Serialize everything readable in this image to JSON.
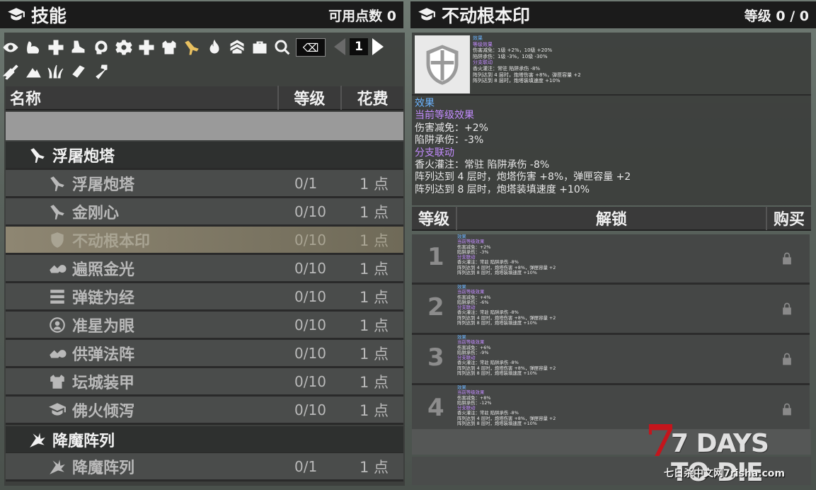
{
  "left": {
    "title": "技能",
    "points_label": "可用点数 0",
    "page_number": "1",
    "columns": {
      "name": "名称",
      "level": "等级",
      "cost": "花费"
    },
    "category1": {
      "name": "浮屠炮塔"
    },
    "skills": [
      {
        "name": "浮屠炮塔",
        "level": "0/1",
        "cost": "1 点",
        "icon": "turret-icon"
      },
      {
        "name": "金刚心",
        "level": "0/10",
        "cost": "1 点",
        "icon": "turret-icon"
      },
      {
        "name": "不动根本印",
        "level": "0/10",
        "cost": "1 点",
        "icon": "shield-icon"
      },
      {
        "name": "遍照金光",
        "level": "0/10",
        "cost": "1 点",
        "icon": "sawblade-icon"
      },
      {
        "name": "弹链为经",
        "level": "0/10",
        "cost": "1 点",
        "icon": "ammo-belt-icon"
      },
      {
        "name": "准星为眼",
        "level": "0/10",
        "cost": "1 点",
        "icon": "crosshair-person-icon"
      },
      {
        "name": "供弹法阵",
        "level": "0/10",
        "cost": "1 点",
        "icon": "sawblade-icon"
      },
      {
        "name": "坛城装甲",
        "level": "0/10",
        "cost": "1 点",
        "icon": "armor-icon"
      },
      {
        "name": "佛火倾泻",
        "level": "0/10",
        "cost": "1 点",
        "icon": "graduation-cap-icon"
      }
    ],
    "category2": {
      "name": "降魔阵列"
    },
    "skill_last": {
      "name": "降魔阵列",
      "level": "0/1",
      "cost": "1 点"
    }
  },
  "right": {
    "title": "不动根本印",
    "level_label": "等级 0 / 0",
    "mini": [
      {
        "t": "效果",
        "c": "blue"
      },
      {
        "t": "等级效果",
        "c": "purple"
      },
      {
        "t": "伤害减免：1级 +2%，10级 +20%",
        "c": "white"
      },
      {
        "t": "陷阱承伤：1级 -3%，10级 -30%",
        "c": "white"
      },
      {
        "t": "分支联动",
        "c": "purple"
      },
      {
        "t": "香火灌注：常驻 陷阱承伤 -8%",
        "c": "white"
      },
      {
        "t": "阵列达到 4 层时，炮塔伤害 +8%，弹匣容量 +2",
        "c": "white"
      },
      {
        "t": "阵列达到 8 层时，炮塔装填速度 +10%",
        "c": "white"
      }
    ],
    "desc": [
      {
        "t": "效果",
        "c": "blue"
      },
      {
        "t": "当前等级效果",
        "c": "purple"
      },
      {
        "t": "伤害减免：+2%",
        "c": "white"
      },
      {
        "t": "陷阱承伤：-3%",
        "c": "white"
      },
      {
        "t": "分支联动",
        "c": "purple"
      },
      {
        "t": "香火灌注：常驻 陷阱承伤 -8%",
        "c": "white"
      },
      {
        "t": "阵列达到 4 层时，炮塔伤害 +8%，弹匣容量 +2",
        "c": "white"
      },
      {
        "t": "阵列达到 8 层时，炮塔装填速度 +10%",
        "c": "white"
      }
    ],
    "columns": {
      "level": "等级",
      "unlock": "解锁",
      "buy": "购买"
    },
    "rows": [
      {
        "num": "1",
        "lines": [
          [
            "效果",
            "blue"
          ],
          [
            "当前等级效果",
            "purple"
          ],
          [
            "伤害减免：+2%",
            "white"
          ],
          [
            "陷阱承伤：-3%",
            "white"
          ],
          [
            "分支联动",
            "purple"
          ],
          [
            "香火灌注：常驻 陷阱承伤 -8%",
            "white"
          ],
          [
            "阵列达到 4 层时，炮塔伤害 +8%，弹匣容量 +2",
            "white"
          ],
          [
            "阵列达到 8 层时，炮塔装填速度 +10%",
            "white"
          ]
        ]
      },
      {
        "num": "2",
        "lines": [
          [
            "效果",
            "blue"
          ],
          [
            "当前等级效果",
            "purple"
          ],
          [
            "伤害减免：+4%",
            "white"
          ],
          [
            "陷阱承伤：-6%",
            "white"
          ],
          [
            "分支联动",
            "purple"
          ],
          [
            "香火灌注：常驻 陷阱承伤 -8%",
            "white"
          ],
          [
            "阵列达到 4 层时，炮塔伤害 +8%，弹匣容量 +2",
            "white"
          ],
          [
            "阵列达到 8 层时，炮塔装填速度 +10%",
            "white"
          ]
        ]
      },
      {
        "num": "3",
        "lines": [
          [
            "效果",
            "blue"
          ],
          [
            "当前等级效果",
            "purple"
          ],
          [
            "伤害减免：+6%",
            "white"
          ],
          [
            "陷阱承伤：-9%",
            "white"
          ],
          [
            "分支联动",
            "purple"
          ],
          [
            "香火灌注：常驻 陷阱承伤 -8%",
            "white"
          ],
          [
            "阵列达到 4 层时，炮塔伤害 +8%，弹匣容量 +2",
            "white"
          ],
          [
            "阵列达到 8 层时，炮塔装填速度 +10%",
            "white"
          ]
        ]
      },
      {
        "num": "4",
        "lines": [
          [
            "效果",
            "blue"
          ],
          [
            "当前等级效果",
            "purple"
          ],
          [
            "伤害减免：+8%",
            "white"
          ],
          [
            "陷阱承伤：-12%",
            "white"
          ],
          [
            "分支联动",
            "purple"
          ],
          [
            "香火灌注：常驻 陷阱承伤 -8%",
            "white"
          ],
          [
            "阵列达到 4 层时，炮塔伤害 +8%，弹匣容量 +2",
            "white"
          ],
          [
            "阵列达到 8 层时，炮塔装填速度 +10%",
            "white"
          ]
        ]
      }
    ]
  },
  "watermark": {
    "logo": "7 DAYS TO DIE",
    "site": "七日杀中文网7risha.com"
  },
  "colors": {
    "header_bar": "#1b1b1b",
    "row": "#4a4c4b",
    "selected": "#8e8672",
    "effect_blue": "#6bb4ff",
    "effect_purple": "#c38cff"
  }
}
